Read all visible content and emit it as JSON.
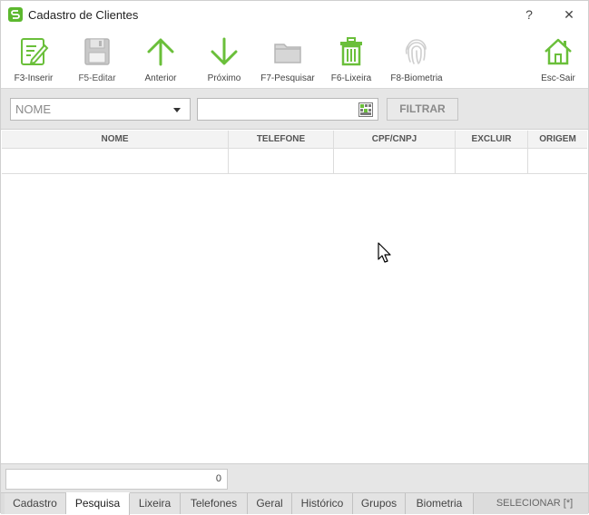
{
  "window": {
    "title": "Cadastro de Clientes",
    "help_label": "?",
    "close_label": "✕"
  },
  "toolbar": {
    "items": [
      {
        "label": "F3-Inserir",
        "icon": "edit-icon"
      },
      {
        "label": "F5-Editar",
        "icon": "floppy-icon"
      },
      {
        "label": "Anterior",
        "icon": "arrow-up-icon"
      },
      {
        "label": "Próximo",
        "icon": "arrow-down-icon"
      },
      {
        "label": "F7-Pesquisar",
        "icon": "folder-icon"
      },
      {
        "label": "F6-Lixeira",
        "icon": "trash-icon"
      },
      {
        "label": "F8-Biometria",
        "icon": "fingerprint-icon"
      },
      {
        "label": "Esc-Sair",
        "icon": "home-icon"
      }
    ]
  },
  "filter": {
    "field_selected": "NOME",
    "search_value": "",
    "button_label": "FILTRAR"
  },
  "grid": {
    "columns": [
      "NOME",
      "TELEFONE",
      "CPF/CNPJ",
      "EXCLUIR",
      "ORIGEM"
    ],
    "rows": []
  },
  "footer": {
    "record_count": "0"
  },
  "tabs": {
    "items": [
      "Cadastro",
      "Pesquisa",
      "Lixeira",
      "Telefones",
      "Geral",
      "Histórico",
      "Grupos",
      "Biometria"
    ],
    "active": "Pesquisa",
    "select_label": "SELECIONAR [*]"
  },
  "colors": {
    "accent_green": "#6abf3a",
    "disabled_gray": "#b5b5b5"
  }
}
